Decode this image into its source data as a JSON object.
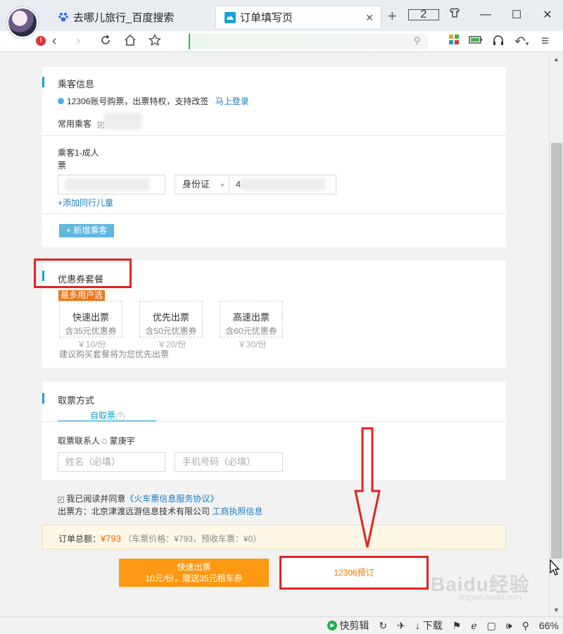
{
  "browser": {
    "tabs": [
      {
        "label": "去哪儿旅行_百度搜索",
        "active": false
      },
      {
        "label": "订单填写页",
        "active": true
      }
    ],
    "tab_count": "2",
    "alert_badge": "!",
    "status": {
      "clip_label": "快剪辑",
      "download_label": "下载",
      "zoom": "66%"
    }
  },
  "passenger": {
    "title": "乘客信息",
    "promo_text": "12306账号购票，出票特权，支持改签",
    "login_link": "马上登录",
    "frequent_label": "常用乘客",
    "passenger_label": "乘客1-成人",
    "ticket_label": "票",
    "id_type": "身份证",
    "id_prefix": "4",
    "add_child": "+添加同行儿童",
    "add_passenger": "+ 新增乘客"
  },
  "coupon": {
    "title": "优惠券套餐",
    "hot_tag": "最多用户选",
    "packages": [
      {
        "name": "快速出票",
        "content": "含35元优惠券",
        "price": "￥10/份"
      },
      {
        "name": "优先出票",
        "content": "含50元优惠券",
        "price": "￥20/份"
      },
      {
        "name": "高速出票",
        "content": "含60元优惠券",
        "price": "￥30/份"
      }
    ],
    "tip": "建议购买套餐将为您优先出票"
  },
  "pickup": {
    "title": "取票方式",
    "tab_label": "自取票",
    "help": "?",
    "contact_label": "取票联系人",
    "contact_name": "蒙庚宇",
    "name_placeholder": "姓名（必填）",
    "phone_placeholder": "手机号码（必填）"
  },
  "agreement": {
    "prefix": "我已阅读并同意",
    "link": "《火车票信息服务协议》",
    "issuer": "出票方：北京津渡远游信息技术有限公司",
    "license_link": "工商执照信息"
  },
  "summary": {
    "label": "订单总额：",
    "total": "¥793",
    "detail": "（车票价格：¥793，预收车票：¥0）"
  },
  "actions": {
    "fast_title": "快速出票",
    "fast_sub": "10元/份，赠送35元租车券",
    "book_label": "12306预订"
  },
  "watermark": {
    "text": "Baidu经验",
    "sub": "jingyan.baidu.com"
  },
  "colors": {
    "accent_blue": "#1aa1d5",
    "highlight_red": "#e32320",
    "orange_button": "#ff9812"
  }
}
